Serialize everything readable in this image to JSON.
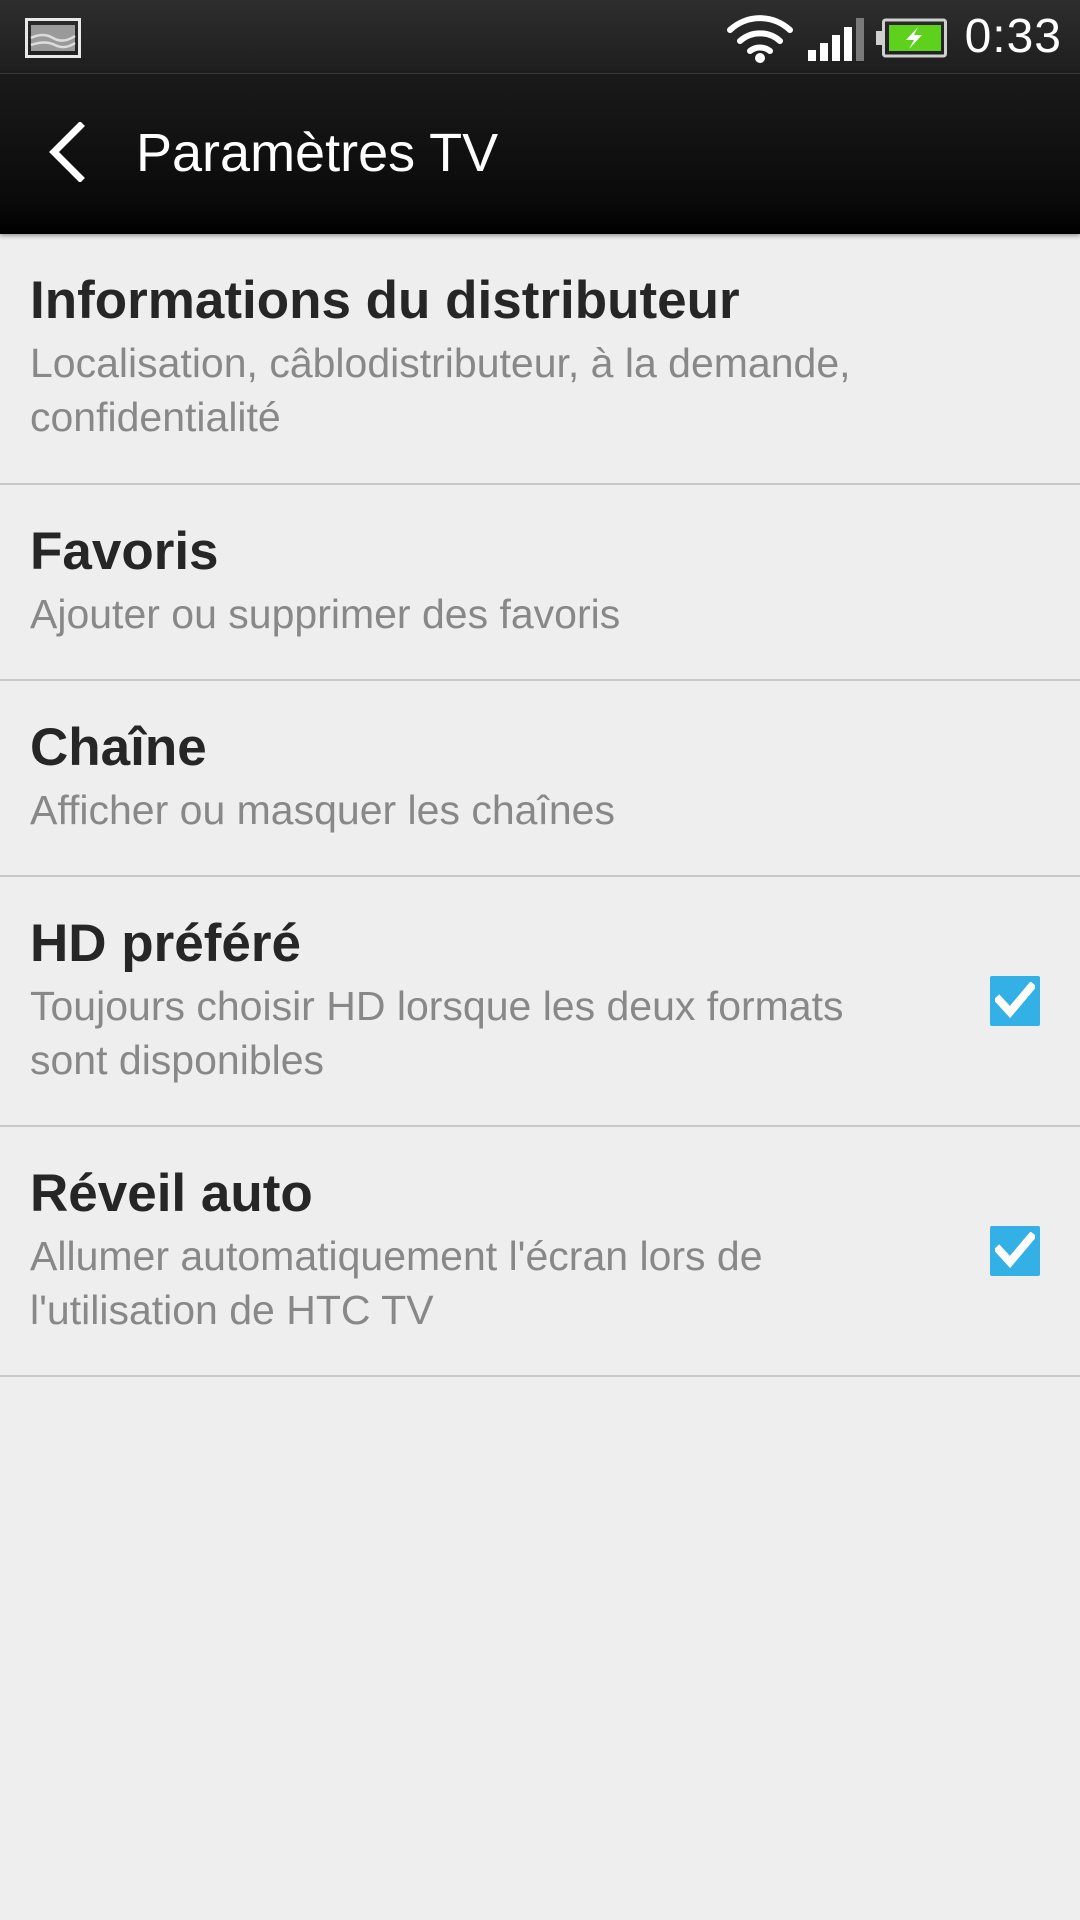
{
  "status_bar": {
    "notification_icon": "image-notification-icon",
    "wifi_icon": "wifi-icon",
    "signal_icon": "cell-signal-icon",
    "battery_icon": "battery-charging-icon",
    "time": "0:33",
    "battery_color": "#5dd11b"
  },
  "action_bar": {
    "back_icon": "chevron-left-icon",
    "title": "Paramètres TV"
  },
  "settings": [
    {
      "title": "Informations du distributeur",
      "subtitle": "Localisation, câblodistributeur, à la demande, confidentialité"
    },
    {
      "title": "Favoris",
      "subtitle": "Ajouter ou supprimer des favoris"
    },
    {
      "title": "Chaîne",
      "subtitle": "Afficher ou masquer les chaînes"
    },
    {
      "title": "HD préféré",
      "subtitle": "Toujours choisir HD lorsque les deux formats sont disponibles",
      "checked": true
    },
    {
      "title": "Réveil auto",
      "subtitle": "Allumer automatiquement l'écran lors de l'utilisation de HTC TV",
      "checked": true
    }
  ],
  "colors": {
    "checkbox": "#33b0e5",
    "background": "#eeeeee",
    "title_text": "#262626",
    "subtitle_text": "#888888"
  }
}
